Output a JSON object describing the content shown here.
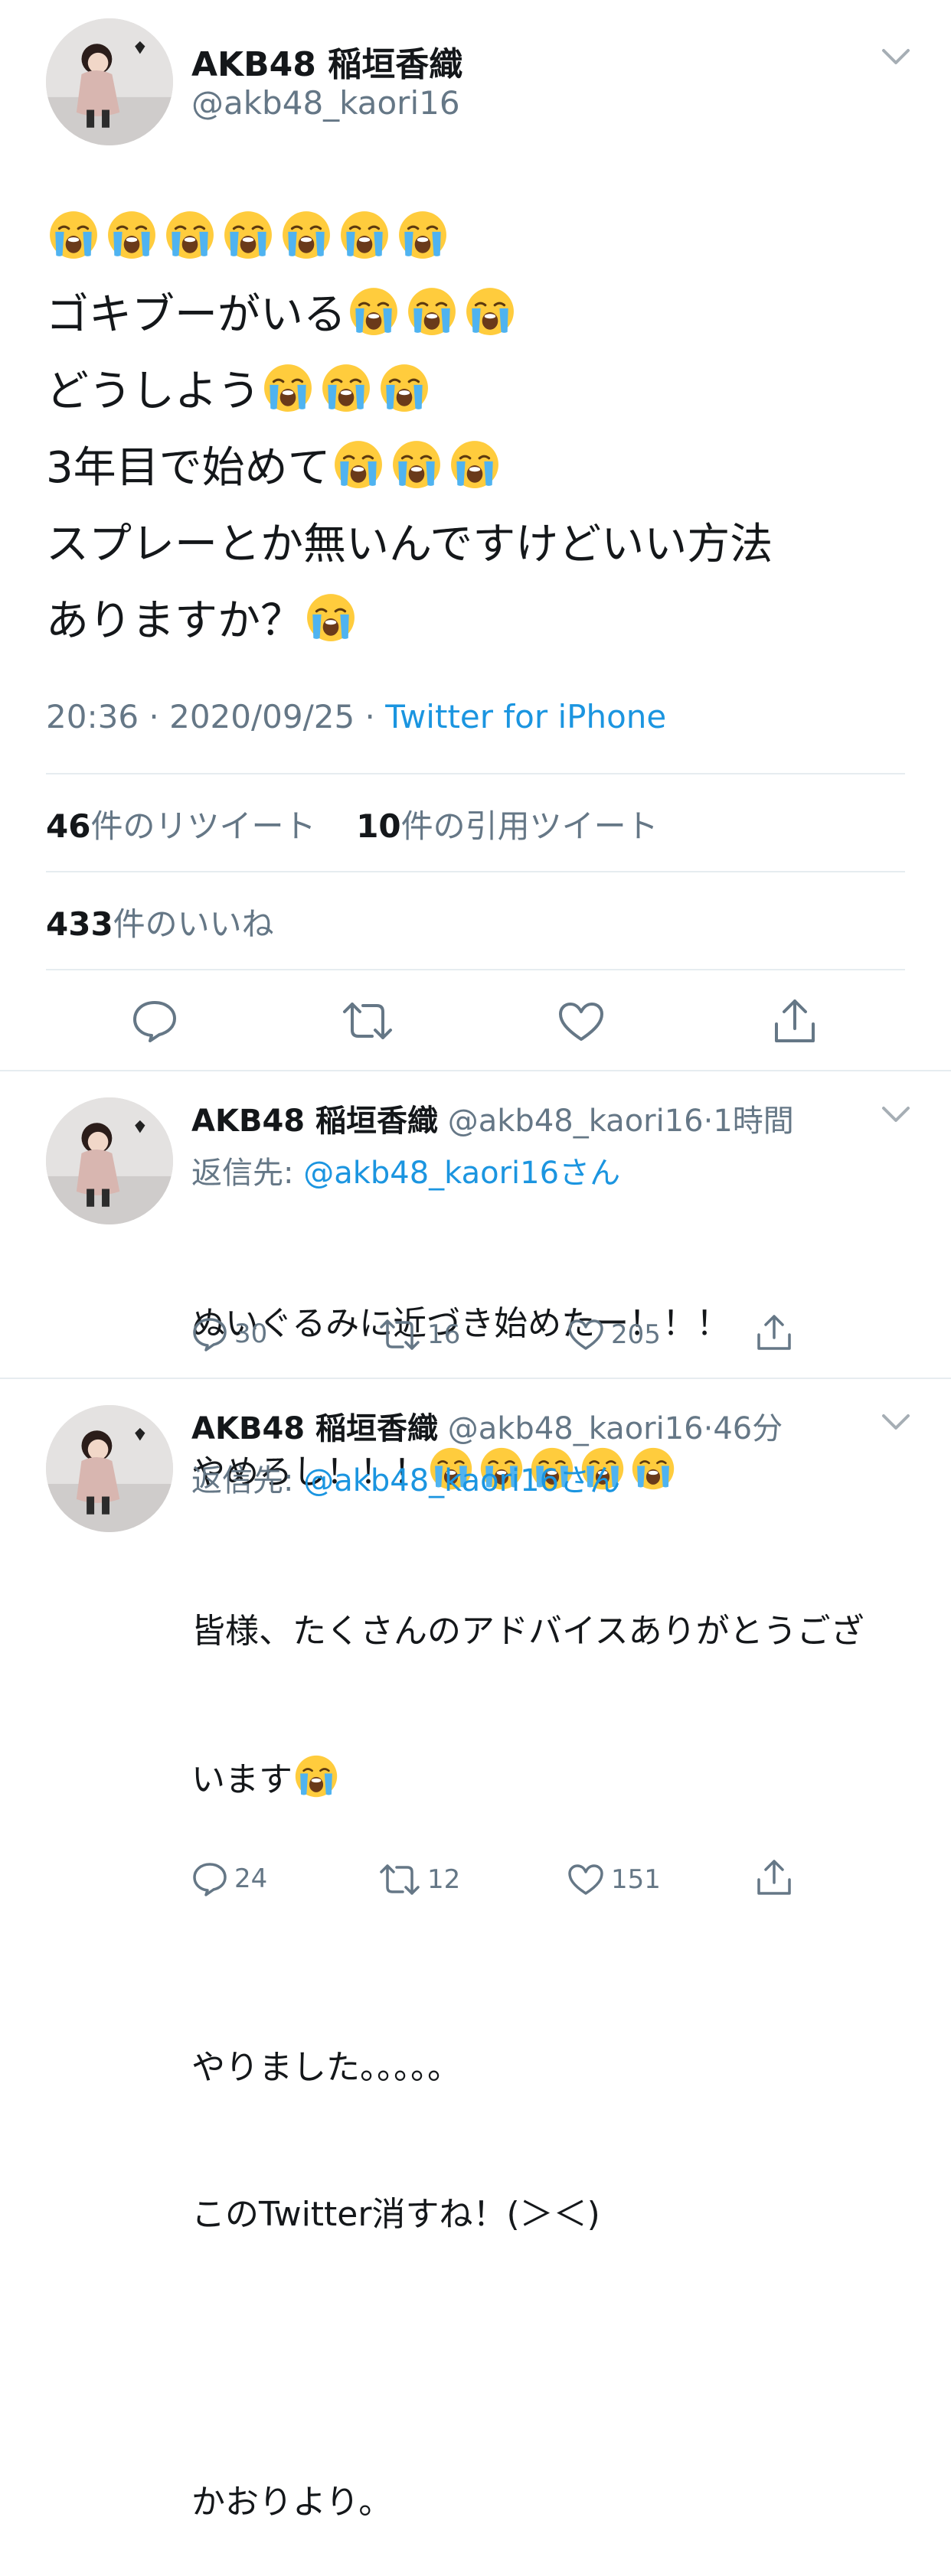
{
  "main_tweet": {
    "display_name": "AKB48  稲垣香織",
    "handle": "@akb48_kaori16",
    "text_line2": "ゴキブーがいる",
    "text_line3": "どうしよう",
    "text_line4": "3年目で始めて",
    "text_line5": "スプレーとか無いんですけどいい方法",
    "text_line6": "ありますか？",
    "time": "20:36",
    "date": "2020/09/25",
    "source": "Twitter for iPhone",
    "retweet_count": "46",
    "retweet_label": "件のリツイート",
    "quote_count": "10",
    "quote_label": "件の引用ツイート",
    "like_count": "433",
    "like_label": "件のいいね"
  },
  "replies": [
    {
      "display_name": "AKB48  稲垣香織",
      "handle": "@akb48_kaori16",
      "time_ago": "1時間",
      "reply_to_prefix": "返信先: ",
      "reply_to_handle": "@akb48_kaori16さん",
      "line1": "ぬいぐるみに近づき始めたー！！！",
      "line2": "やめろし！！！",
      "reply_count": "30",
      "retweet_count": "16",
      "like_count": "205"
    },
    {
      "display_name": "AKB48  稲垣香織",
      "handle": "@akb48_kaori16",
      "time_ago": "46分",
      "reply_to_prefix": "返信先: ",
      "reply_to_handle": "@akb48_kaori16さん",
      "line1": "皆様、たくさんのアドバイスありがとうござ",
      "line2": "います",
      "line3": "やりました。。。。。",
      "line4": "このTwitter消すね！(＞＜)",
      "line5": "かおりより。",
      "reply_count": "24",
      "retweet_count": "12",
      "like_count": "151"
    }
  ],
  "icons": {
    "emoji": "loudly-crying-face",
    "reply": "reply-icon",
    "retweet": "retweet-icon",
    "like": "heart-icon",
    "share": "share-icon",
    "menu": "chevron-down-icon"
  },
  "colors": {
    "link": "#1b95e0",
    "secondary": "#657786",
    "divider": "#e6ecf0"
  }
}
